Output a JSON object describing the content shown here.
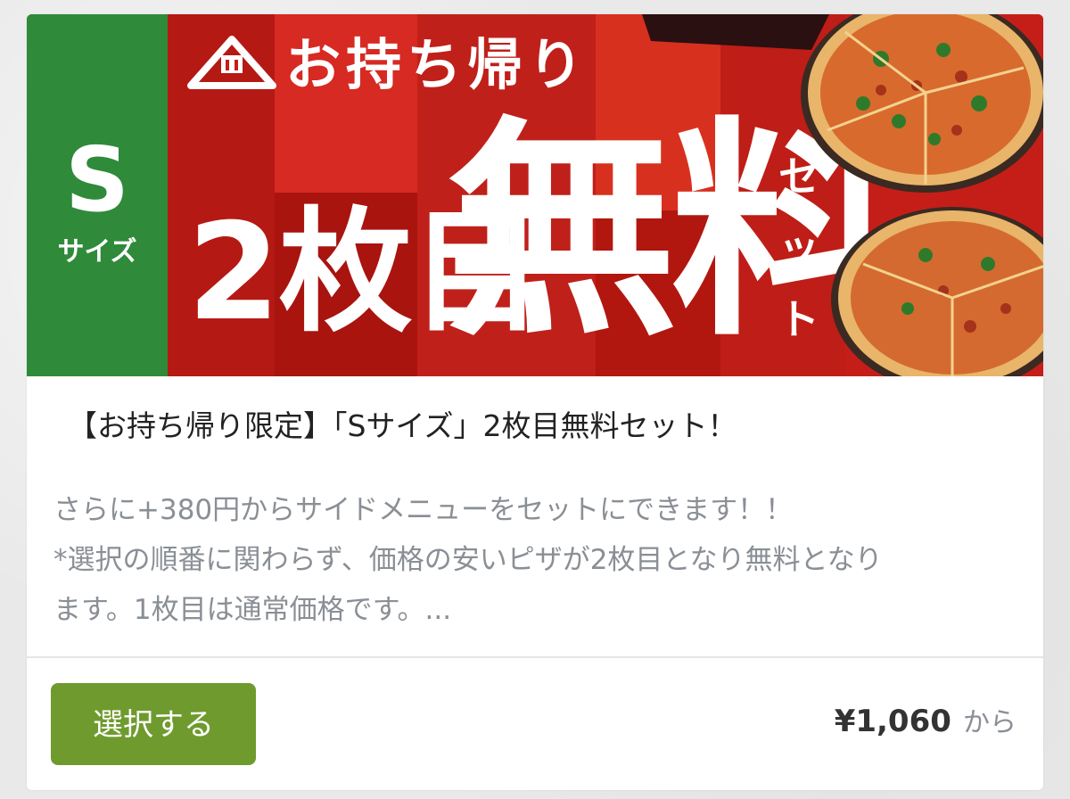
{
  "banner": {
    "size_letter": "S",
    "size_word": "サイズ",
    "takeout_title": "お持ち帰り",
    "second_label": "2枚目",
    "free_label": "無料",
    "set_chars": [
      "セ",
      "ッ",
      "ト"
    ],
    "colors": {
      "red": "#c8211b",
      "green": "#2f8a3a"
    }
  },
  "item": {
    "title": "【お持ち帰り限定】「Sサイズ」2枚目無料セット！",
    "description_lines": [
      "さらに+380円からサイドメニューをセットにできます！！",
      "*選択の順番に関わらず、価格の安いピザが2枚目となり無料となり",
      "ます。1枚目は通常価格です。..."
    ]
  },
  "footer": {
    "select_label": "選択する",
    "price": "¥1,060",
    "price_suffix": "から",
    "button_color": "#6f9b2e"
  }
}
